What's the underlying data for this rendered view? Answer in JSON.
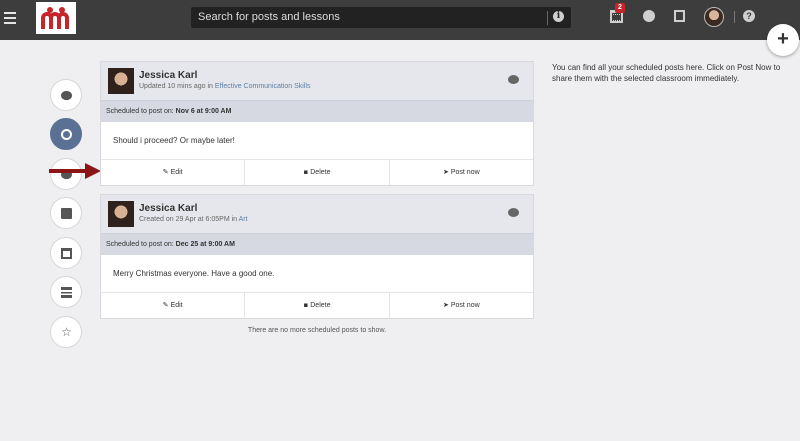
{
  "header": {
    "search_placeholder": "Search for posts and lessons",
    "notification_count": "2",
    "brand_color": "#c8252b"
  },
  "fab": {
    "label": "+"
  },
  "left_nav": {
    "items": [
      {
        "icon": "comment-icon",
        "active": false
      },
      {
        "icon": "clock-icon",
        "active": true
      },
      {
        "icon": "comments-icon",
        "active": false
      },
      {
        "icon": "book-icon",
        "active": false
      },
      {
        "icon": "window-icon",
        "active": false
      },
      {
        "icon": "server-icon",
        "active": false
      },
      {
        "icon": "star-icon",
        "active": false
      }
    ]
  },
  "posts": [
    {
      "author": "Jessica Karl",
      "meta_prefix": "Updated 10 mins ago in ",
      "meta_link": "Effective Communication Skills",
      "schedule_prefix": "Scheduled to post on: ",
      "schedule_date": "Nov 6 at 9:00 AM",
      "body": "Should i proceed? Or maybe later!",
      "actions": {
        "edit": "Edit",
        "delete": "Delete",
        "post_now": "Post now"
      }
    },
    {
      "author": "Jessica Karl",
      "meta_prefix": "Created on 29 Apr at 6:05PM in ",
      "meta_link": "Art",
      "schedule_prefix": "Scheduled to post on: ",
      "schedule_date": "Dec 25 at 9:00 AM",
      "body": "Merry Christmas everyone. Have a good one.",
      "actions": {
        "edit": "Edit",
        "delete": "Delete",
        "post_now": "Post now"
      }
    }
  ],
  "empty_note": "There are no more scheduled posts to show.",
  "side_help": "You can find all your scheduled posts here. Click on Post Now to share them with the selected classroom immediately."
}
